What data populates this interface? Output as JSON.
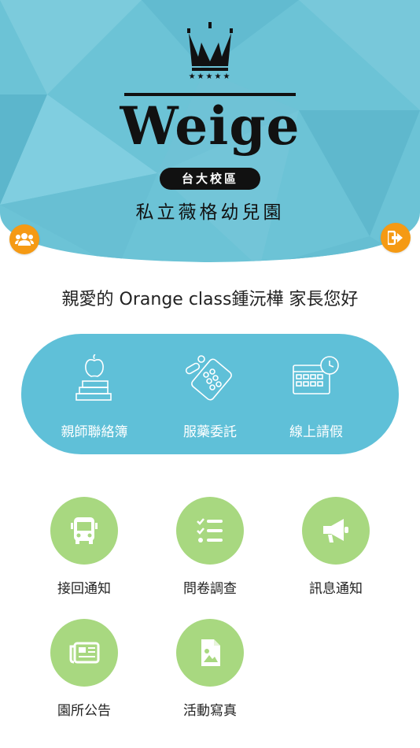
{
  "header": {
    "brand_title": "Weige",
    "campus": "台大校區",
    "school_name": "私立薇格幼兒園",
    "stars": "★★★★★"
  },
  "greeting": "親愛的 Orange class鍾沅樺 家長您好",
  "primary_features": [
    {
      "label": "親師聯絡簿",
      "icon": "apple-books-icon"
    },
    {
      "label": "服藥委託",
      "icon": "pills-icon"
    },
    {
      "label": "線上請假",
      "icon": "calendar-clock-icon"
    }
  ],
  "secondary_features": [
    {
      "label": "接回通知",
      "icon": "bus-icon"
    },
    {
      "label": "問卷調查",
      "icon": "checklist-icon"
    },
    {
      "label": "訊息通知",
      "icon": "megaphone-icon"
    },
    {
      "label": "園所公告",
      "icon": "newspaper-icon"
    },
    {
      "label": "活動寫真",
      "icon": "photo-file-icon"
    }
  ],
  "colors": {
    "header_teal": "#6cc3d6",
    "accent_orange": "#f59a14",
    "pill_teal": "#5fc0d8",
    "green_circle": "#a8d880"
  }
}
